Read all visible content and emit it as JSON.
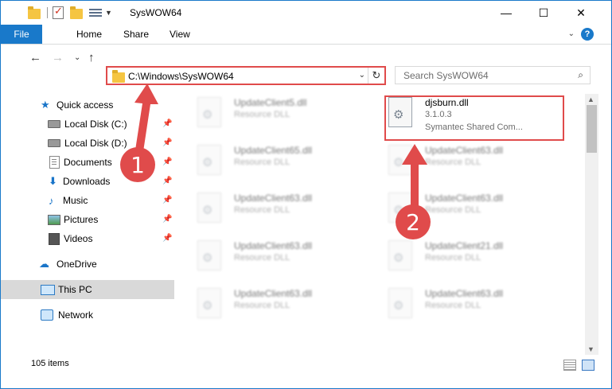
{
  "window": {
    "title": "SysWOW64",
    "minimize": "—",
    "maximize": "☐",
    "close": "✕"
  },
  "ribbon": {
    "file": "File",
    "home": "Home",
    "share": "Share",
    "view": "View",
    "expand": "⌄",
    "help": "?"
  },
  "nav": {
    "back": "←",
    "forward": "→",
    "recent": "⌄",
    "up": "↑",
    "address": "C:\\Windows\\SysWOW64",
    "address_caret": "⌄",
    "refresh": "↻",
    "search_placeholder": "Search SysWOW64",
    "search_icon": "⌕"
  },
  "sidebar": {
    "items": [
      {
        "label": "Quick access",
        "icon": "star-icon"
      },
      {
        "label": "Local Disk (C:)",
        "icon": "disk-icon",
        "pinned": true
      },
      {
        "label": "Local Disk (D:)",
        "icon": "disk-icon",
        "pinned": true
      },
      {
        "label": "Documents",
        "icon": "document-icon",
        "pinned": true
      },
      {
        "label": "Downloads",
        "icon": "download-icon",
        "pinned": true
      },
      {
        "label": "Music",
        "icon": "music-icon",
        "pinned": true
      },
      {
        "label": "Pictures",
        "icon": "pictures-icon",
        "pinned": true
      },
      {
        "label": "Videos",
        "icon": "videos-icon",
        "pinned": true
      },
      {
        "label": "OneDrive",
        "icon": "cloud-icon"
      },
      {
        "label": "This PC",
        "icon": "computer-icon",
        "selected": true
      },
      {
        "label": "Network",
        "icon": "network-icon"
      }
    ],
    "pin": "📌"
  },
  "files": {
    "col1": [
      {
        "name": "UpdateClient5.dll",
        "desc": "Resource DLL"
      },
      {
        "name": "UpdateClient65.dll",
        "desc": "Resource DLL"
      },
      {
        "name": "UpdateClient63.dll",
        "desc": "Resource DLL"
      },
      {
        "name": "UpdateClient63.dll",
        "desc": "Resource DLL"
      },
      {
        "name": "UpdateClient63.dll",
        "desc": "Resource DLL"
      }
    ],
    "highlighted": {
      "name": "djsburn.dll",
      "version": "3.1.0.3",
      "company": "Symantec Shared Com..."
    },
    "col2": [
      {
        "name": "UpdateClient63.dll",
        "desc": "Resource DLL"
      },
      {
        "name": "UpdateClient63.dll",
        "desc": "Resource DLL"
      },
      {
        "name": "UpdateClient21.dll",
        "desc": "Resource DLL"
      },
      {
        "name": "UpdateClient63.dll",
        "desc": "Resource DLL"
      }
    ]
  },
  "status": {
    "count": "105 items"
  },
  "annotations": {
    "step1": "1",
    "step2": "2",
    "color": "#e04b4b"
  }
}
